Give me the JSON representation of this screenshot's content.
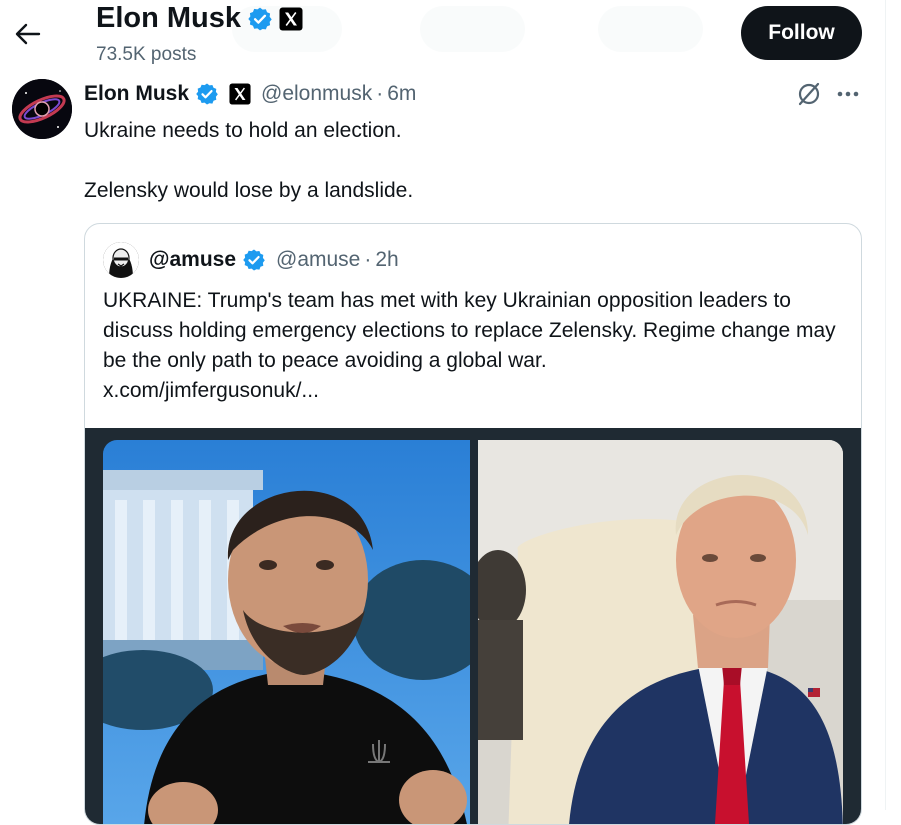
{
  "header": {
    "back_icon": "arrow-left-icon",
    "name": "Elon Musk",
    "posts": "73.5K posts",
    "follow_label": "Follow"
  },
  "tweet": {
    "name": "Elon Musk",
    "handle": "@elonmusk",
    "separator": "·",
    "time": "6m",
    "text": "Ukraine needs to hold an election.\n\nZelensky would lose by a landslide."
  },
  "quote": {
    "name": "@amuse",
    "handle": "@amuse",
    "separator": "·",
    "time": "2h",
    "text": "UKRAINE: Trump's team has met with key Ukrainian opposition leaders to discuss holding emergency elections to replace Zelensky. Regime change may be the only path to peace avoiding a global war.",
    "link": "x.com/jimfergusonuk/..."
  },
  "colors": {
    "verified_blue": "#1d9bf0",
    "text_primary": "#0f1419",
    "text_secondary": "#536471",
    "follow_bg": "#0f1419"
  }
}
